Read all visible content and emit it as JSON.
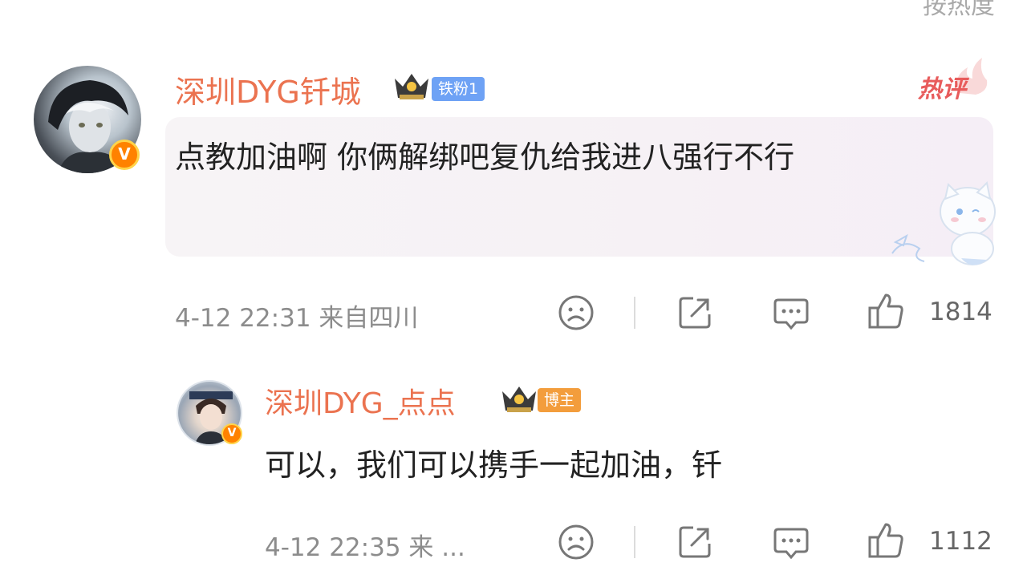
{
  "header": {
    "sort_label": "按热度"
  },
  "comment": {
    "username": "深圳DYG钎城",
    "fan_badge": "铁粉1",
    "hot_label": "热评",
    "text": "点教加油啊 你俩解绑吧复仇给我进八强行不行",
    "timestamp": "4-12 22:31",
    "location": "来自四川",
    "likes": "1814"
  },
  "reply": {
    "username": "深圳DYG_点点",
    "author_badge": "博主",
    "text": "可以，我们可以携手一起加油，钎",
    "timestamp": "4-12 22:35",
    "location": "来 ...",
    "likes": "1112"
  },
  "icons": {
    "verified": "V",
    "dislike": "sad-face-icon",
    "share": "share-icon",
    "reply": "comment-icon",
    "like": "thumbs-up-icon"
  },
  "colors": {
    "username": "#eb7350",
    "fan_badge": "#6ea2f5",
    "author_badge": "#f39d3c",
    "hot": "#e85b5b",
    "verified": "#ff8200"
  }
}
